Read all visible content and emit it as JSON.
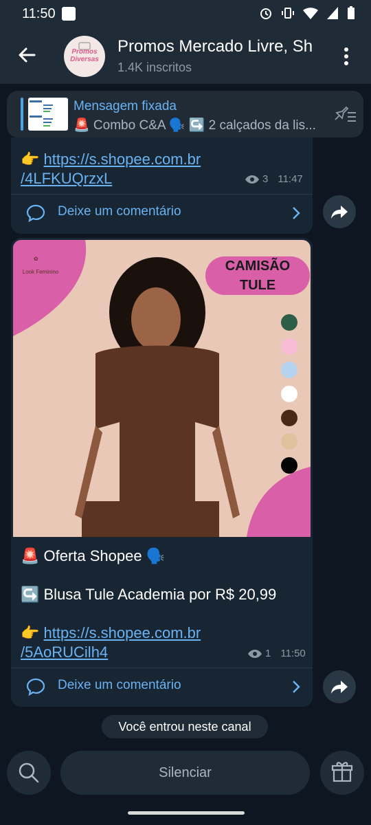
{
  "status_bar": {
    "time": "11:50"
  },
  "header": {
    "title": "Promos Mercado Livre, Sh",
    "subtitle": "1.4K inscritos",
    "avatar_text": "Promos Diversas"
  },
  "pinned": {
    "title": "Mensagem fixada",
    "text": "🚨 Combo C&A 🗣️ ↪️ 2 calçados da lis..."
  },
  "messages": [
    {
      "link_line1": "https://s.shopee.com.br",
      "link_line2": "/4LFKUQrzxL",
      "pointer": "👉",
      "views": "3",
      "time": "11:47",
      "comment_label": "Deixe um comentário"
    },
    {
      "line1": "🚨 Oferta Shopee 🗣️",
      "line2": "↪️ Blusa Tule Academia por R$ 20,99",
      "pointer": "👉",
      "link_line1": "https://s.shopee.com.br",
      "link_line2": "/5AoRUCilh4",
      "views": "1",
      "time": "11:50",
      "comment_label": "Deixe um comentário"
    }
  ],
  "photo": {
    "brand": "Look Feminino",
    "title_line1": "CAMISÃO",
    "title_line2": "TULE",
    "swatches": [
      "#2f5e46",
      "#f7bcd6",
      "#b5d3ee",
      "#ffffff",
      "#4a2a17",
      "#dfc19d",
      "#050505"
    ]
  },
  "system_notice": "Você entrou neste canal",
  "bottom": {
    "mute_label": "Silenciar"
  },
  "colors": {
    "accent": "#6ab3f3",
    "bubble": "#182533",
    "background": "#0e1621"
  }
}
